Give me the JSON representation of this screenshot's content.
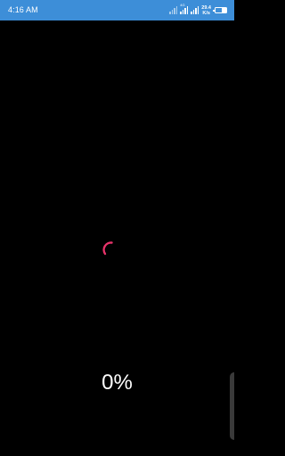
{
  "status_bar": {
    "time": "4:16 AM",
    "sim_tag": "4G",
    "net_speed_value": "29.4",
    "net_speed_unit": "K/s",
    "battery_level": 0.45,
    "background_color": "#3d8ed8"
  },
  "loader": {
    "icon": "spinner-icon",
    "color": "#e8336a",
    "progress_label": "0%"
  },
  "edge_panel": {
    "icon": "edge-handle"
  }
}
